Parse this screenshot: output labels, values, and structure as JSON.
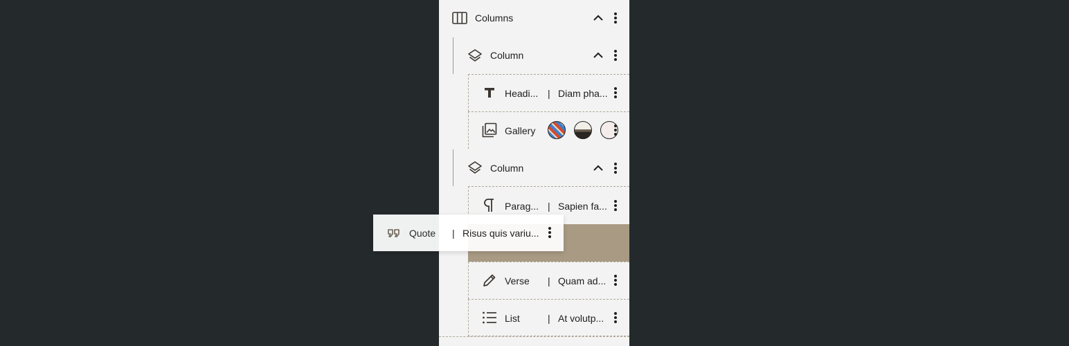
{
  "list_view": {
    "items": [
      {
        "label": "Columns",
        "icon": "columns-icon"
      },
      {
        "label": "Column",
        "icon": "stack-icon"
      },
      {
        "label": "Headi...",
        "excerpt": "Diam pha...",
        "icon": "heading-icon"
      },
      {
        "label": "Gallery",
        "icon": "gallery-icon"
      },
      {
        "label": "Column",
        "icon": "stack-icon"
      },
      {
        "label": "Parag...",
        "excerpt": "Sapien fa...",
        "icon": "paragraph-icon"
      },
      {
        "label": "Verse",
        "excerpt": "Quam ad...",
        "icon": "pencil-icon"
      },
      {
        "label": "List",
        "excerpt": "At volutp...",
        "icon": "list-icon"
      }
    ],
    "separator": "|"
  },
  "drag_preview": {
    "label": "Quote",
    "excerpt": "Risus quis variu...",
    "icon": "quote-icon"
  },
  "colors": {
    "background": "#24292c",
    "panel": "#f3f3f3",
    "accent": "#a89a83",
    "line": "#a89680"
  }
}
